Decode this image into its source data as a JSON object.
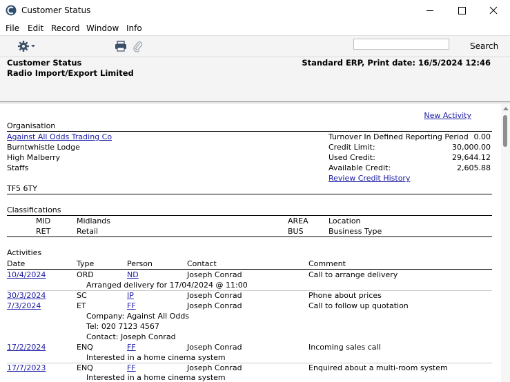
{
  "window": {
    "title": "Customer Status"
  },
  "menu": [
    "File",
    "Edit",
    "Record",
    "Window",
    "Info"
  ],
  "search": {
    "placeholder": "",
    "button_label": "Search"
  },
  "header": {
    "report_title": "Customer Status",
    "company": "Radio Import/Export Limited",
    "system_print": "Standard ERP, Print date: 16/5/2024 12:46"
  },
  "new_activity_label": "New Activity",
  "organisation": {
    "section_title": "Organisation",
    "name": "Against All Odds Trading Co",
    "address": [
      "Burntwhistle Lodge",
      "High Malberry",
      "Staffs",
      "",
      "TF5 6TY"
    ],
    "stats": [
      {
        "label": "Turnover In Defined Reporting Period",
        "value": "0.00"
      },
      {
        "label": "Credit Limit:",
        "value": "30,000.00"
      },
      {
        "label": "Used Credit:",
        "value": "29,644.12"
      },
      {
        "label": "Available Credit:",
        "value": "2,605.88"
      }
    ],
    "review_link": "Review Credit History"
  },
  "classifications": {
    "section_title": "Classifications",
    "rows": [
      {
        "code": "MID",
        "name": "Midlands",
        "type_code": "AREA",
        "type_name": "Location"
      },
      {
        "code": "RET",
        "name": "Retail",
        "type_code": "BUS",
        "type_name": "Business Type"
      }
    ]
  },
  "activities": {
    "section_title": "Activities",
    "columns": [
      "Date",
      "Type",
      "Person",
      "Contact",
      "Comment"
    ],
    "rows": [
      {
        "date": "10/4/2024",
        "type": "ORD",
        "person": "ND",
        "contact": "Joseph Conrad",
        "comment": "Call to arrange delivery",
        "details": [
          "Arranged delivery for 17/04/2024 @ 11:00"
        ]
      },
      {
        "date": "30/3/2024",
        "type": "SC",
        "person": "IP",
        "contact": "Joseph Conrad",
        "comment": "Phone about prices",
        "details": []
      },
      {
        "date": "7/3/2024",
        "type": "ET",
        "person": "FF",
        "contact": "Joseph Conrad",
        "comment": "Call to follow up quotation",
        "details": [
          "Company: Against All Odds",
          "Tel: 020 7123 4567",
          "Contact: Joseph Conrad"
        ]
      },
      {
        "date": "17/2/2024",
        "type": "ENQ",
        "person": "FF",
        "contact": "Joseph Conrad",
        "comment": "Incoming sales call",
        "details": [
          "Interested in a home cinema system"
        ]
      },
      {
        "date": "17/7/2023",
        "type": "ENQ",
        "person": "FF",
        "contact": "Joseph Conrad",
        "comment": "Enquired about a multi-room system",
        "details": [
          "Interested in a home cinema system"
        ]
      }
    ]
  }
}
